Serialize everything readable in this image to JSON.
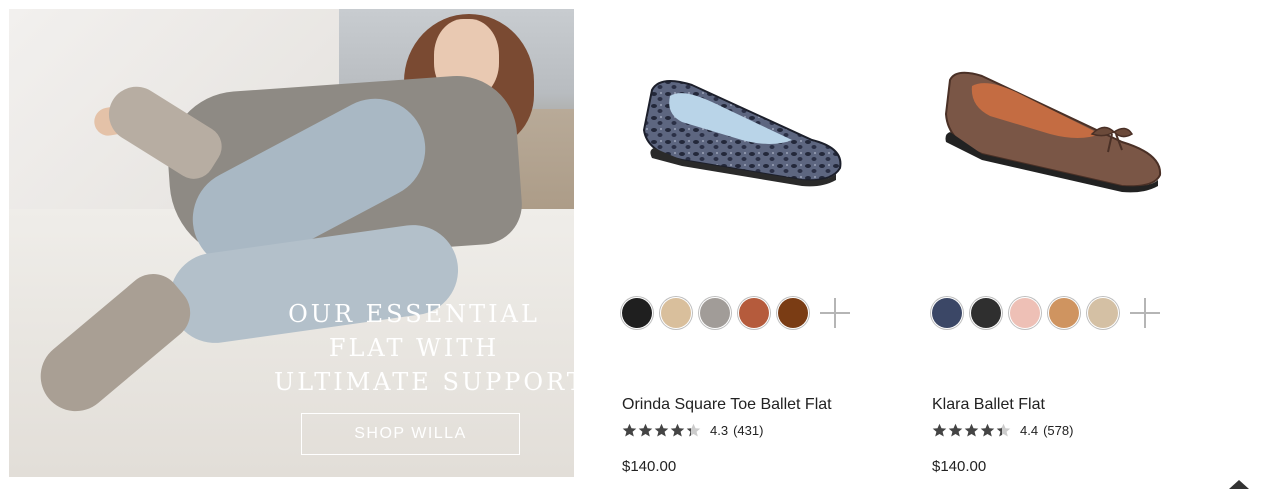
{
  "promo": {
    "headline_lines": [
      "OUR ESSENTIAL",
      "FLAT WITH",
      "ULTIMATE SUPPORT"
    ],
    "cta_label": "SHOP WILLA"
  },
  "products": [
    {
      "name": "Orinda Square Toe Ballet Flat",
      "rating": "4.3",
      "rating_value": 4.3,
      "reviews": "(431)",
      "price": "$140.00",
      "swatches": [
        "#1f1f1f",
        "#d9bf9c",
        "#a19c98",
        "#b55b3c",
        "#7a3c14"
      ]
    },
    {
      "name": "Klara Ballet Flat",
      "rating": "4.4",
      "rating_value": 4.4,
      "reviews": "(578)",
      "price": "$140.00",
      "swatches": [
        "#3b4766",
        "#2f2f2f",
        "#eec0b6",
        "#cf9460",
        "#d4c0a4"
      ]
    }
  ],
  "colors": {
    "star_filled": "#444444",
    "star_empty": "#cccccc"
  },
  "icons": {
    "more_colors": "plus-icon",
    "back_to_top": "caret-up-icon"
  }
}
